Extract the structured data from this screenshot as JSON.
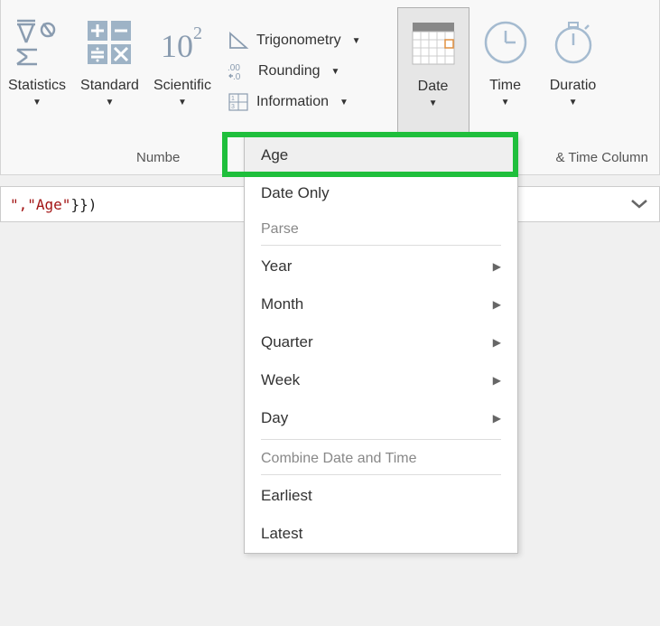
{
  "ribbon": {
    "statistics": "Statistics",
    "standard": "Standard",
    "scientific": "Scientific",
    "trigonometry": "Trigonometry",
    "rounding": "Rounding",
    "information": "Information",
    "date": "Date",
    "time": "Time",
    "duration": "Duratio",
    "group_left": "Numbe",
    "group_right": "& Time Column"
  },
  "formula": {
    "fragment_prefix": "\", ",
    "fragment_age": "\"Age\"",
    "fragment_suffix": "}})"
  },
  "menu": {
    "age": "Age",
    "date_only": "Date Only",
    "parse": "Parse",
    "year": "Year",
    "month": "Month",
    "quarter": "Quarter",
    "week": "Week",
    "day": "Day",
    "combine": "Combine Date and Time",
    "earliest": "Earliest",
    "latest": "Latest"
  }
}
